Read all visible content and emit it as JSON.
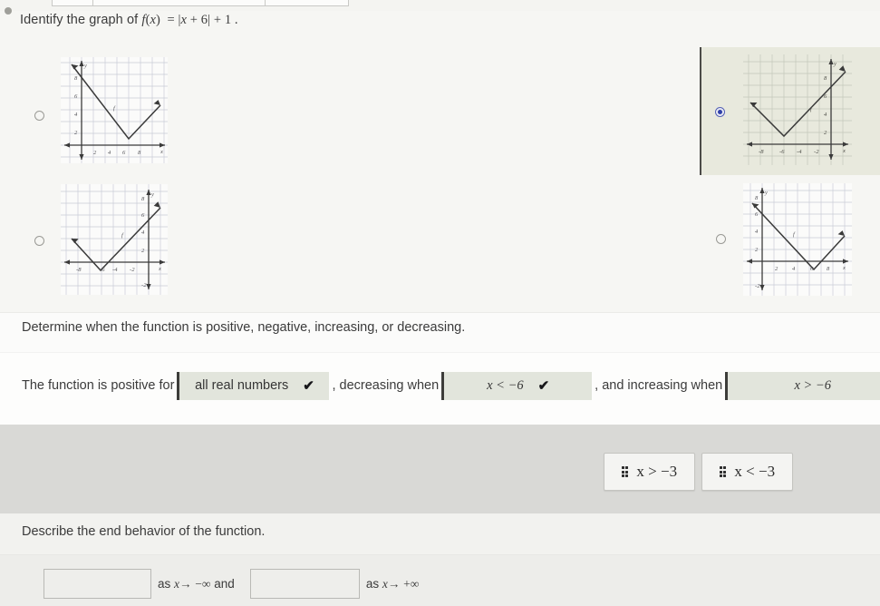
{
  "question": {
    "prompt_prefix": "Identify the graph of",
    "function_expr": "f(x) = |x + 6| + 1 .",
    "function_name": "f",
    "function_rule": "|x + 6| + 1"
  },
  "choices": [
    {
      "id": "choice-a",
      "position": "top-left",
      "selected": false,
      "vertex": [
        6,
        1
      ],
      "curve_label": "f",
      "x_ticks": [
        "2",
        "4",
        "6",
        "8"
      ],
      "y_ticks": [
        "2",
        "4",
        "6",
        "8"
      ],
      "x_axis_label": "x",
      "y_axis_label": "y"
    },
    {
      "id": "choice-b",
      "position": "bottom-left",
      "selected": false,
      "vertex": [
        -6,
        -1
      ],
      "curve_label": "f",
      "x_ticks": [
        "-8",
        "-6",
        "-4",
        "-2"
      ],
      "y_ticks": [
        "2",
        "4",
        "6",
        "8",
        "-2"
      ],
      "x_axis_label": "x",
      "y_axis_label": "y"
    },
    {
      "id": "choice-c",
      "position": "top-right",
      "selected": true,
      "vertex": [
        -6,
        1
      ],
      "curve_label": "f",
      "x_ticks": [
        "-8",
        "-6",
        "-4",
        "-2"
      ],
      "y_ticks": [
        "2",
        "4",
        "6",
        "8"
      ],
      "x_axis_label": "x",
      "y_axis_label": "y"
    },
    {
      "id": "choice-d",
      "position": "bottom-right",
      "selected": false,
      "vertex": [
        6,
        -1
      ],
      "curve_label": "f",
      "x_ticks": [
        "2",
        "4",
        "6",
        "8"
      ],
      "y_ticks": [
        "2",
        "4",
        "6",
        "8",
        "-2"
      ],
      "x_axis_label": "x",
      "y_axis_label": "y"
    }
  ],
  "determine_section": {
    "instruction": "Determine when the function is positive, negative, increasing, or decreasing.",
    "sentence": {
      "lead": "The function is positive for",
      "mid": ", decreasing when",
      "tail": ", and increasing when"
    },
    "dropdowns": [
      {
        "name": "positive-for",
        "value": "all real numbers",
        "confirmed": true,
        "check_glyph": "✔"
      },
      {
        "name": "decreasing-when",
        "value": "x < −6",
        "confirmed": true,
        "check_glyph": "✔"
      },
      {
        "name": "increasing-when",
        "value": "x > −6",
        "confirmed": false,
        "check_glyph": ""
      }
    ]
  },
  "drag_tiles": [
    {
      "name": "tile-x-greater-neg3",
      "label": "x > −3",
      "grip": "drag-handle-icon"
    },
    {
      "name": "tile-x-less-neg3",
      "label": "x < −3",
      "grip": "drag-handle-icon"
    }
  ],
  "end_behavior": {
    "instruction": "Describe the end behavior of the function.",
    "input_1_value": "",
    "input_1_placeholder": "",
    "text_1": "as x→ − ∞ and",
    "input_2_value": "",
    "input_2_placeholder": "",
    "text_2": "as x→ + ∞"
  },
  "colors": {
    "accent_selected": "#2f3fa8",
    "dropdown_bg": "#e2e5dc",
    "dropdown_bar": "#3d3d3a",
    "band_gray": "#d9d9d6",
    "panel_cream": "#e8e9dd",
    "grid_line": "#c9ccd6",
    "axis": "#3a3a3a"
  }
}
